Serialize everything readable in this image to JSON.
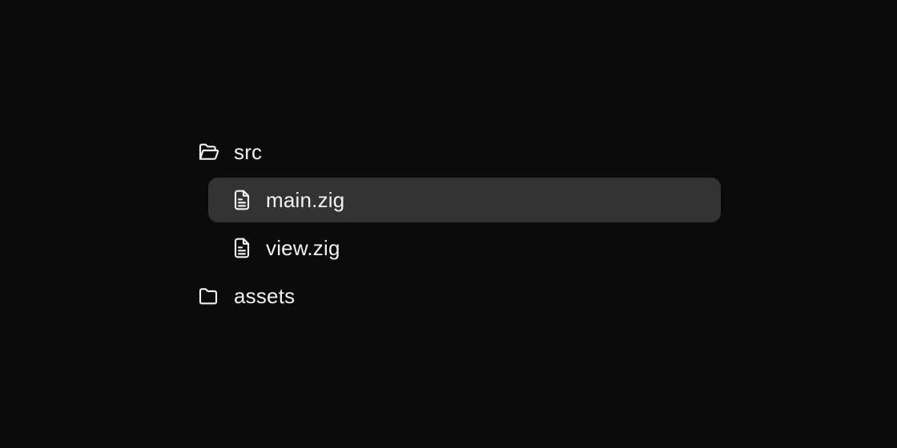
{
  "tree": {
    "items": [
      {
        "label": "src",
        "kind": "folder",
        "state": "open",
        "icon": "folder-open-icon"
      },
      {
        "label": "main.zig",
        "kind": "file",
        "selected": true,
        "icon": "file-text-icon"
      },
      {
        "label": "view.zig",
        "kind": "file",
        "selected": false,
        "icon": "file-text-icon"
      },
      {
        "label": "assets",
        "kind": "folder",
        "state": "closed",
        "icon": "folder-icon"
      }
    ]
  },
  "colors": {
    "background": "#0b0b0b",
    "selected_row": "#333333",
    "text": "#f2f2f2"
  }
}
